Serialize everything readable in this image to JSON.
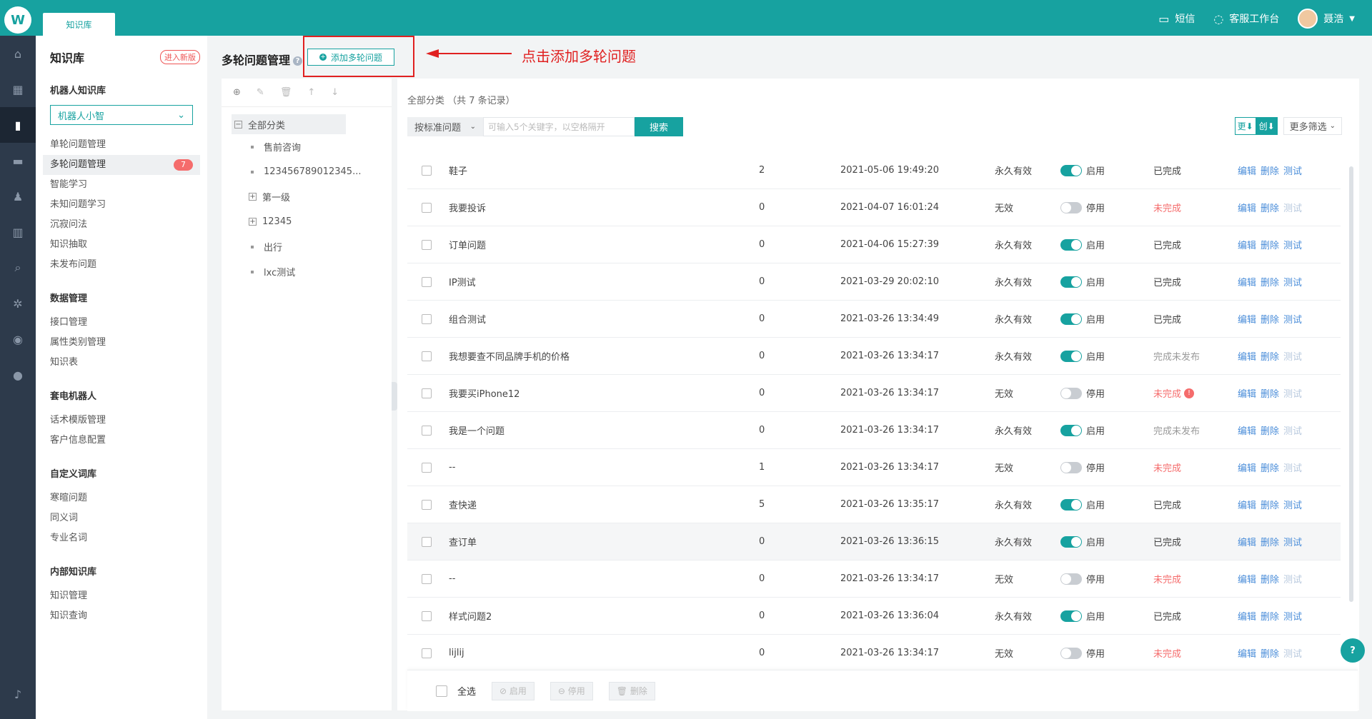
{
  "app": {
    "logo_glyph": "W",
    "top_tab": "知识库"
  },
  "topbar": {
    "sms": "短信",
    "workbench": "客服工作台",
    "user": "聂浩"
  },
  "sidenav": {
    "title": "知识库",
    "new_version": "进入新版",
    "groups": [
      {
        "title": "机器人知识库",
        "select": "机器人小智",
        "items": [
          {
            "label": "单轮问题管理"
          },
          {
            "label": "多轮问题管理",
            "badge": "7",
            "active": true
          },
          {
            "label": "智能学习"
          },
          {
            "label": "未知问题学习"
          },
          {
            "label": "沉寂问法"
          },
          {
            "label": "知识抽取"
          },
          {
            "label": "未发布问题"
          }
        ]
      },
      {
        "title": "数据管理",
        "items": [
          {
            "label": "接口管理"
          },
          {
            "label": "属性类别管理"
          },
          {
            "label": "知识表"
          }
        ]
      },
      {
        "title": "套电机器人",
        "items": [
          {
            "label": "话术模版管理"
          },
          {
            "label": "客户信息配置"
          }
        ]
      },
      {
        "title": "自定义词库",
        "items": [
          {
            "label": "寒暄问题"
          },
          {
            "label": "同义词"
          },
          {
            "label": "专业名词"
          }
        ]
      },
      {
        "title": "内部知识库",
        "items": [
          {
            "label": "知识管理"
          },
          {
            "label": "知识查询"
          }
        ]
      }
    ]
  },
  "header": {
    "title": "多轮问题管理",
    "add_button": "添加多轮问题",
    "annotation": "点击添加多轮问题"
  },
  "tree": {
    "root": "全部分类",
    "children": [
      {
        "label": "售前咨询",
        "type": "leaf"
      },
      {
        "label": "123456789012345...",
        "type": "leaf"
      },
      {
        "label": "第一级",
        "type": "folder"
      },
      {
        "label": "12345",
        "type": "folder"
      },
      {
        "label": "出行",
        "type": "leaf"
      },
      {
        "label": "lxc测试",
        "type": "leaf"
      }
    ]
  },
  "main": {
    "crumb": "全部分类 （共 7 条记录）",
    "search_select": "按标准问题",
    "search_placeholder": "可输入5个关键字，以空格隔开",
    "search_button": "搜索",
    "sort_update": "更⬇",
    "sort_create": "创⬇",
    "more_filter": "更多筛选"
  },
  "ops": {
    "edit": "编辑",
    "delete": "删除",
    "test": "测试"
  },
  "rows": [
    {
      "name": "鞋子",
      "num": "2",
      "time": "2021-05-06 19:49:20",
      "valid": "永久有效",
      "enabled": true,
      "switch": "启用",
      "status": "已完成",
      "st": "done",
      "test_on": true
    },
    {
      "name": "我要投诉",
      "num": "0",
      "time": "2021-04-07 16:01:24",
      "valid": "无效",
      "enabled": false,
      "switch": "停用",
      "status": "未完成",
      "st": "undone",
      "test_on": false
    },
    {
      "name": "订单问题",
      "num": "0",
      "time": "2021-04-06 15:27:39",
      "valid": "永久有效",
      "enabled": true,
      "switch": "启用",
      "status": "已完成",
      "st": "done",
      "test_on": true
    },
    {
      "name": "IP测试",
      "num": "0",
      "time": "2021-03-29 20:02:10",
      "valid": "永久有效",
      "enabled": true,
      "switch": "启用",
      "status": "已完成",
      "st": "done",
      "test_on": true
    },
    {
      "name": "组合测试",
      "num": "0",
      "time": "2021-03-26 13:34:49",
      "valid": "永久有效",
      "enabled": true,
      "switch": "启用",
      "status": "已完成",
      "st": "done",
      "test_on": true
    },
    {
      "name": "我想要查不同品牌手机的价格",
      "num": "0",
      "time": "2021-03-26 13:34:17",
      "valid": "永久有效",
      "enabled": true,
      "switch": "启用",
      "status": "完成未发布",
      "st": "unpub",
      "test_on": false
    },
    {
      "name": "我要买iPhone12",
      "num": "0",
      "time": "2021-03-26 13:34:17",
      "valid": "无效",
      "enabled": false,
      "switch": "停用",
      "status": "未完成",
      "st": "undone",
      "warn": true,
      "test_on": false
    },
    {
      "name": "我是一个问题",
      "num": "0",
      "time": "2021-03-26 13:34:17",
      "valid": "永久有效",
      "enabled": true,
      "switch": "启用",
      "status": "完成未发布",
      "st": "unpub",
      "test_on": false
    },
    {
      "name": "--",
      "num": "1",
      "time": "2021-03-26 13:34:17",
      "valid": "无效",
      "enabled": false,
      "switch": "停用",
      "status": "未完成",
      "st": "undone",
      "test_on": false
    },
    {
      "name": "查快递",
      "num": "5",
      "time": "2021-03-26 13:35:17",
      "valid": "永久有效",
      "enabled": true,
      "switch": "启用",
      "status": "已完成",
      "st": "done",
      "test_on": true
    },
    {
      "name": "查订单",
      "num": "0",
      "time": "2021-03-26 13:36:15",
      "valid": "永久有效",
      "enabled": true,
      "switch": "启用",
      "status": "已完成",
      "st": "done",
      "test_on": true,
      "hover": true
    },
    {
      "name": "--",
      "num": "0",
      "time": "2021-03-26 13:34:17",
      "valid": "无效",
      "enabled": false,
      "switch": "停用",
      "status": "未完成",
      "st": "undone",
      "test_on": false
    },
    {
      "name": "样式问题2",
      "num": "0",
      "time": "2021-03-26 13:36:04",
      "valid": "永久有效",
      "enabled": true,
      "switch": "启用",
      "status": "已完成",
      "st": "done",
      "test_on": true
    },
    {
      "name": "lijlij",
      "num": "0",
      "time": "2021-03-26 13:34:17",
      "valid": "无效",
      "enabled": false,
      "switch": "停用",
      "status": "未完成",
      "st": "undone",
      "test_on": false
    }
  ],
  "bottom": {
    "select_all": "全选",
    "enable": "⊘ 启用",
    "disable": "⊖ 停用",
    "delete": "🗑 删除"
  },
  "float_help": "?",
  "colors": {
    "brand": "#17a2a0",
    "danger": "#f56c6c",
    "link": "#4a8dd9",
    "rail": "#2d3a4b"
  }
}
